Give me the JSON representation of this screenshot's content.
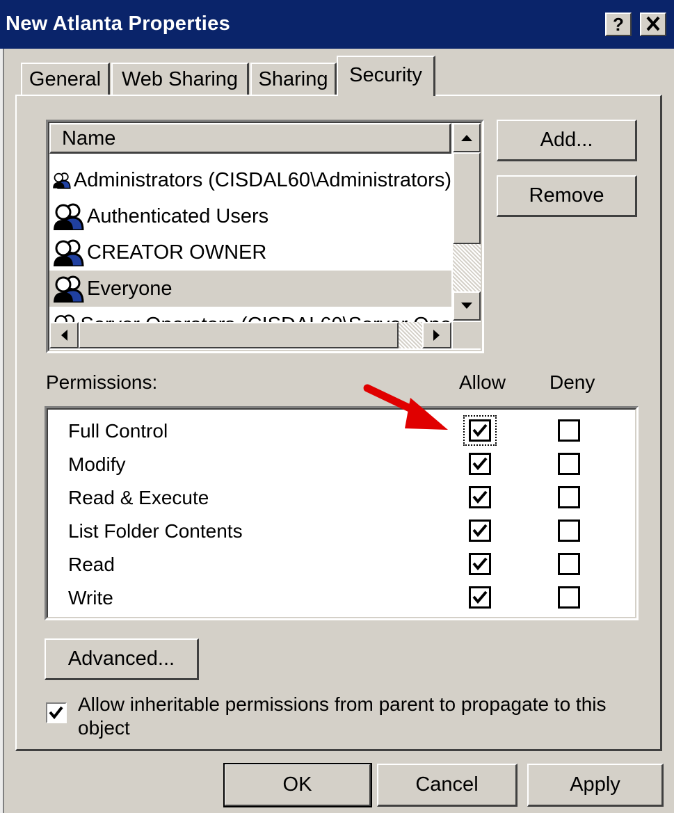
{
  "window": {
    "title": "New Atlanta Properties",
    "help_btn": "?",
    "close_btn": "✕"
  },
  "tabs": [
    {
      "label": "General",
      "active": false
    },
    {
      "label": "Web Sharing",
      "active": false
    },
    {
      "label": "Sharing",
      "active": false
    },
    {
      "label": "Security",
      "active": true
    }
  ],
  "users_list": {
    "header": "Name",
    "items": [
      {
        "label": "Administrators (CISDAL60\\Administrators)",
        "icon": "users-group-icon"
      },
      {
        "label": "Authenticated Users",
        "icon": "users-group-icon"
      },
      {
        "label": "CREATOR OWNER",
        "icon": "users-group-icon"
      },
      {
        "label": "Everyone",
        "icon": "users-group-icon",
        "selected": true
      },
      {
        "label": "Server Operators (CISDAL60\\Server Ope",
        "icon": "users-group-icon"
      }
    ]
  },
  "buttons": {
    "add": "Add...",
    "remove": "Remove",
    "advanced": "Advanced...",
    "ok": "OK",
    "cancel": "Cancel",
    "apply": "Apply"
  },
  "permissions": {
    "label": "Permissions:",
    "allow_header": "Allow",
    "deny_header": "Deny",
    "rows": [
      {
        "name": "Full Control",
        "allow": true,
        "deny": false
      },
      {
        "name": "Modify",
        "allow": true,
        "deny": false
      },
      {
        "name": "Read & Execute",
        "allow": true,
        "deny": false
      },
      {
        "name": "List Folder Contents",
        "allow": true,
        "deny": false
      },
      {
        "name": "Read",
        "allow": true,
        "deny": false
      },
      {
        "name": "Write",
        "allow": true,
        "deny": false
      }
    ]
  },
  "inherit": {
    "checked": true,
    "label_line1": "Allow inheritable permissions from parent to propagate to this",
    "label_line2": "object"
  },
  "colors": {
    "titlebar": "#0a246a",
    "dialog_bg": "#d4d0c8",
    "annotation_arrow": "#e00000"
  }
}
